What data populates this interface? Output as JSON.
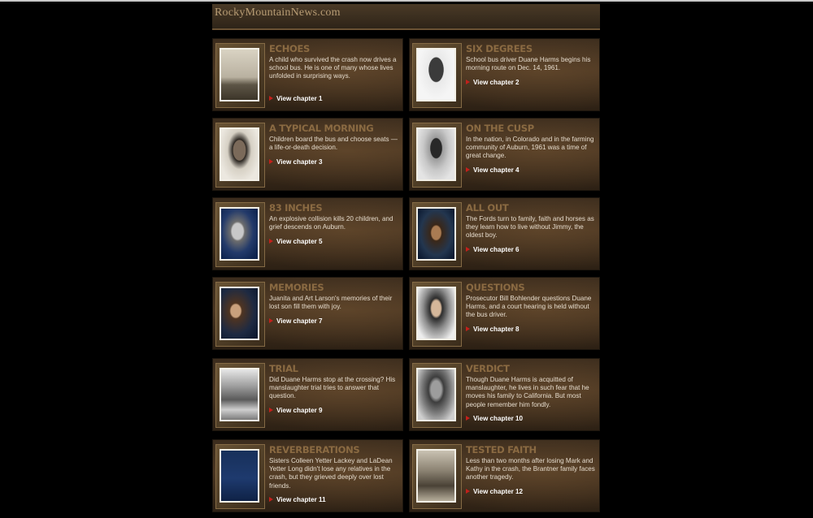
{
  "site": {
    "title": "RockyMountainNews.com"
  },
  "chapters": [
    {
      "title": "ECHOES",
      "desc": "A child who survived the crash now drives a school bus. He is one of many whose lives unfolded in surprising ways.",
      "link": "View chapter 1",
      "photo": "landscape-tracks"
    },
    {
      "title": "SIX DEGREES",
      "desc": "School bus driver Duane Harms begins his morning route on Dec. 14, 1961.",
      "link": "View chapter 2",
      "photo": "portrait-young-man"
    },
    {
      "title": "A TYPICAL MORNING",
      "desc": "Children board the bus and choose seats — a life-or-death decision.",
      "link": "View chapter 3",
      "photo": "portrait-girl"
    },
    {
      "title": "ON THE CUSP",
      "desc": "In the nation, in Colorado and in the farming community of Auburn, 1961 was a time of great change.",
      "link": "View chapter 4",
      "photo": "portrait-boy-cap"
    },
    {
      "title": "83 INCHES",
      "desc": "An explosive collision kills 20 children, and grief descends on Auburn.",
      "link": "View chapter 5",
      "photo": "portrait-elder"
    },
    {
      "title": "ALL OUT",
      "desc": "The Fords turn to family, faith and horses as they learn how to live without Jimmy, the oldest boy.",
      "link": "View chapter 6",
      "photo": "portrait-cowboy"
    },
    {
      "title": "MEMORIES",
      "desc": "Juanita and Art Larson's memories of their lost son fill them with joy.",
      "link": "View chapter 7",
      "photo": "portrait-couple"
    },
    {
      "title": "QUESTIONS",
      "desc": "Prosecutor Bill Bohlender questions Duane Harms, and a court hearing is held without the bus driver.",
      "link": "View chapter 8",
      "photo": "portrait-man-suit"
    },
    {
      "title": "TRIAL",
      "desc": "Did Duane Harms stop at the crossing? His manslaughter trial tries to answer that question.",
      "link": "View chapter 9",
      "photo": "train"
    },
    {
      "title": "VERDICT",
      "desc": "Though Duane Harms is acquitted of manslaughter, he lives in such fear that he moves his family to California. But most people remember him fondly.",
      "link": "View chapter 10",
      "photo": "portrait-man-bw"
    },
    {
      "title": "REVERBERATIONS",
      "desc": "Sisters Colleen Yetter Lackey and LaDean Yetter Long didn't lose any relatives in the crash, but they grieved deeply over lost friends.",
      "link": "View chapter 11",
      "photo": "sisters"
    },
    {
      "title": "TESTED FAITH",
      "desc": "Less than two months after losing Mark and Kathy in the crash, the Brantner family faces another tragedy.",
      "link": "View chapter 12",
      "photo": "family-group"
    }
  ]
}
